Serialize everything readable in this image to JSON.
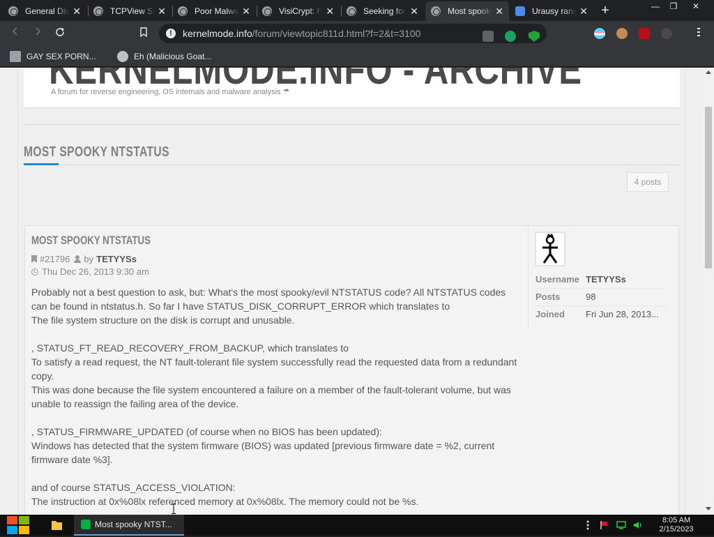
{
  "browser": {
    "tabs": [
      {
        "title": "General Discussion",
        "icon": "globe-icon",
        "active": false
      },
      {
        "title": "TCPView Suspicious",
        "icon": "globe-icon",
        "active": false
      },
      {
        "title": "Poor Malware",
        "icon": "globe-icon",
        "active": false
      },
      {
        "title": "VisiCrypt: Fi",
        "icon": "globe-icon",
        "active": false
      },
      {
        "title": "Seeking for",
        "icon": "globe-icon",
        "active": false
      },
      {
        "title": "Most spooky NTSTATUS",
        "icon": "globe-icon",
        "active": true
      },
      {
        "title": "Urausy ransomware",
        "icon": "quick-icon",
        "active": false
      }
    ],
    "close_glyph": "✕",
    "new_tab_glyph": "+",
    "window_controls": {
      "minimize": "—",
      "restore": "❐",
      "close": "✕"
    },
    "address": {
      "host": "kernelmode.info",
      "path": "/forum/viewtopic811d.html?f=2&t=3100"
    },
    "bookmarks": [
      {
        "label": "GAY SEX PORN...",
        "icon": "bookmark-site-icon"
      },
      {
        "label": "Eh (Malicious Goat...",
        "icon": "globe-icon"
      }
    ]
  },
  "page": {
    "site_title": "KERNELMODE.INFO - ARCHIVE",
    "site_description": "A forum for reverse engineering, OS internals and malware analysis ☂",
    "topic_title": "MOST SPOOKY NTSTATUS",
    "posts_count": "4 posts",
    "post": {
      "heading": "MOST SPOOKY NTSTATUS",
      "post_id": "#21796",
      "by": "by",
      "author": "TETYYSs",
      "date": "Thu Dec 26, 2013 9:30 am",
      "body": [
        "Probably not a best question to ask, but: What's the most spooky/evil NTSTATUS code? All NTSTATUS codes can be found in ntstatus.h. So far I have STATUS_DISK_CORRUPT_ERROR which translates to",
        "The file system structure on the disk is corrupt and unusable.",
        "",
        ", STATUS_FT_READ_RECOVERY_FROM_BACKUP, which translates to",
        "To satisfy a read request, the NT fault-tolerant file system successfully read the requested data from a redundant copy.",
        "This was done because the file system encountered a failure on a member of the fault-tolerant volume, but was unable to reassign the failing area of the device.",
        "",
        ", STATUS_FIRMWARE_UPDATED (of course when no BIOS has been updated):",
        "Windows has detected that the system firmware (BIOS) was updated [previous firmware date = %2, current firmware date %3].",
        "",
        "and of course STATUS_ACCESS_VIOLATION:",
        "The instruction at 0x%08lx referenced memory at 0x%08lx. The memory could not be %s."
      ],
      "profile": {
        "username_label": "Username",
        "username": "TETYYSs",
        "posts_label": "Posts",
        "posts": "98",
        "joined_label": "Joined",
        "joined": "Fri Jun 28, 2013..."
      }
    }
  },
  "taskbar": {
    "app_label": "Most spooky NTST...",
    "time": "8:05 AM",
    "date": "2/15/2023"
  },
  "colors": {
    "accent": "#1b8ad1",
    "tab_bg": "#202124",
    "toolbar_bg": "#35363a"
  }
}
